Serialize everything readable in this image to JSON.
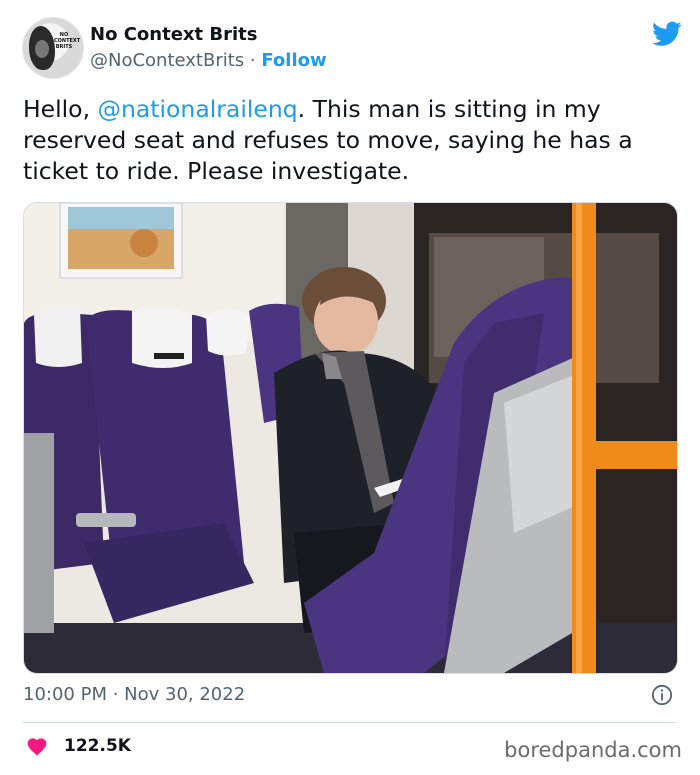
{
  "author": {
    "display_name": "No Context Brits",
    "handle": "@NoContextBrits",
    "separator": " · ",
    "follow_label": "Follow",
    "avatar_text": "NO CONTEXT BRITS"
  },
  "tweet": {
    "text_before": "Hello, ",
    "mention": "@nationalrailenq",
    "text_after": ". This man is sitting in my reserved seat and refuses to move, saying he has a ticket to ride. Please investigate."
  },
  "meta": {
    "time": "10:00 PM",
    "separator": " · ",
    "date": "Nov 30, 2022"
  },
  "engagement": {
    "likes": "122.5K"
  },
  "watermark": "boredpanda.com",
  "colors": {
    "twitter_blue": "#1d9bf0",
    "like_red": "#f91880",
    "text": "#0f1419",
    "secondary": "#536471"
  }
}
